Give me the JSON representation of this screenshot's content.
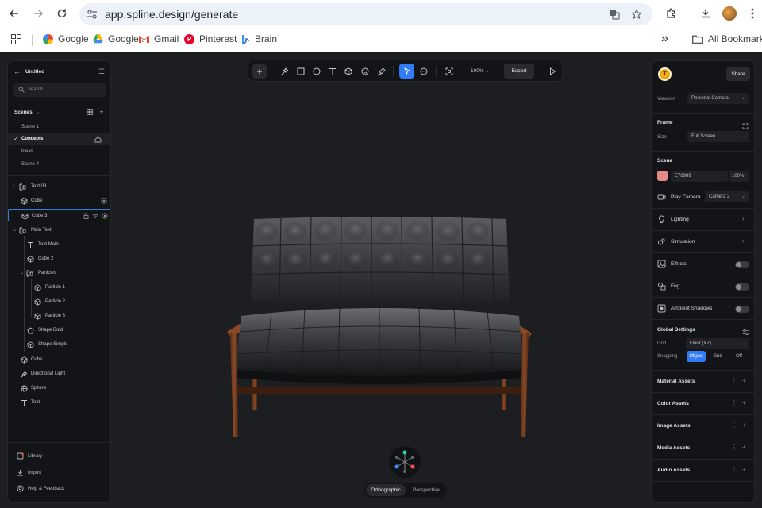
{
  "browser": {
    "url": "app.spline.design/generate",
    "bookmarks": [
      "Google",
      "Google .",
      "Gmail",
      "Pinterest",
      "Brain"
    ],
    "all_bookmarks": "All Bookmarks"
  },
  "left_panel": {
    "title": "Untitled",
    "search_placeholder": "Search",
    "scenes_label": "Scenes",
    "scenes": [
      {
        "label": "Scene 1"
      },
      {
        "label": "Concepts"
      },
      {
        "label": "Ideas"
      },
      {
        "label": "Scene 4"
      }
    ],
    "tree": [
      {
        "label": "Text 03"
      },
      {
        "label": "Cube"
      },
      {
        "label": "Cube 3"
      },
      {
        "label": "Main Text"
      },
      {
        "label": "Text Main"
      },
      {
        "label": "Cube 2"
      },
      {
        "label": "Particles"
      },
      {
        "label": "Particle 1"
      },
      {
        "label": "Particle 2"
      },
      {
        "label": "Particle 3"
      },
      {
        "label": "Shape Bold"
      },
      {
        "label": "Shape Simple"
      },
      {
        "label": "Cube"
      },
      {
        "label": "Directional Light"
      },
      {
        "label": "Sphere"
      },
      {
        "label": "Text"
      }
    ],
    "footer": [
      "Library",
      "Import",
      "Help & Feedback"
    ]
  },
  "toolbar": {
    "zoom": "100%",
    "export": "Export"
  },
  "viewport": {
    "projection": [
      "Orthographic",
      "Perspective"
    ]
  },
  "right_panel": {
    "share": "Share",
    "viewport_label": "Viewport",
    "viewport_value": "Personal Camera",
    "frame_label": "Frame",
    "size_label": "Size",
    "size_value": "Full Screen",
    "scene_label": "Scene",
    "scene_color": "E78989",
    "scene_opacity": "100%",
    "play_camera": "Play Camera",
    "camera_value": "Camera 2",
    "lighting": "Lighting",
    "simulation": "Simulation",
    "effects": "Effects",
    "fog": "Fog",
    "ambient_shadows": "Ambient Shadows",
    "global_settings": "Global Settings",
    "grid_label": "Grid",
    "grid_value": "Floor (XZ)",
    "snapping_label": "Snapping",
    "snapping_options": [
      "Object",
      "Grid",
      "Off"
    ],
    "assets": [
      "Material Assets",
      "Color Assets",
      "Image Assets",
      "Media Assets",
      "Audio Assets"
    ]
  },
  "colors": {
    "accent": "#2f7cf6",
    "scene_swatch": "#E78989"
  }
}
